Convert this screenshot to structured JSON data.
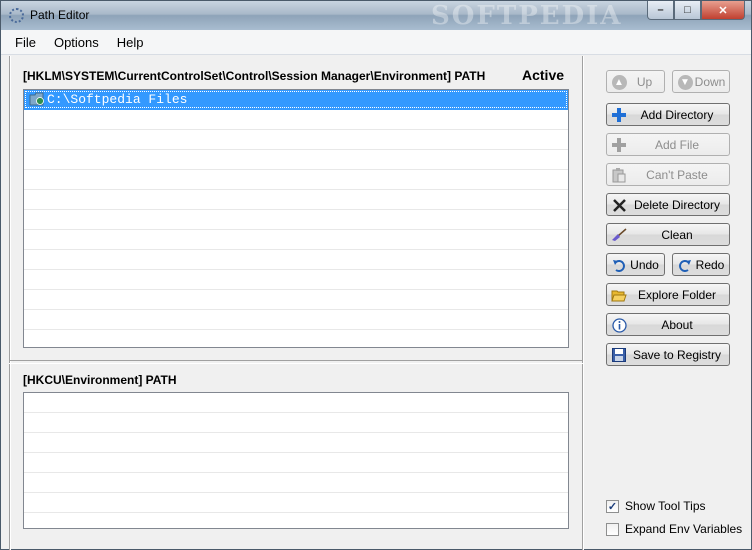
{
  "window": {
    "title": "Path Editor",
    "watermark": "SOFTPEDIA",
    "controls": {
      "minimize": "–",
      "maximize": "□",
      "close": "✕"
    }
  },
  "menu": [
    "File",
    "Options",
    "Help"
  ],
  "hklm_panel": {
    "header": "[HKLM\\SYSTEM\\CurrentControlSet\\Control\\Session Manager\\Environment] PATH",
    "status": "Active",
    "entries": [
      "C:\\Softpedia Files"
    ]
  },
  "hkcu_panel": {
    "header": "[HKCU\\Environment] PATH",
    "entries": []
  },
  "buttons": {
    "up": "Up",
    "down": "Down",
    "add_directory": "Add Directory",
    "add_file": "Add File",
    "cant_paste": "Can't Paste",
    "delete_directory": "Delete Directory",
    "clean": "Clean",
    "undo": "Undo",
    "redo": "Redo",
    "explore_folder": "Explore Folder",
    "about": "About",
    "save_to_registry": "Save to Registry"
  },
  "options": {
    "show_tool_tips": {
      "label": "Show Tool Tips",
      "checked": true
    },
    "expand_env_variables": {
      "label": "Expand Env Variables",
      "checked": false
    }
  }
}
